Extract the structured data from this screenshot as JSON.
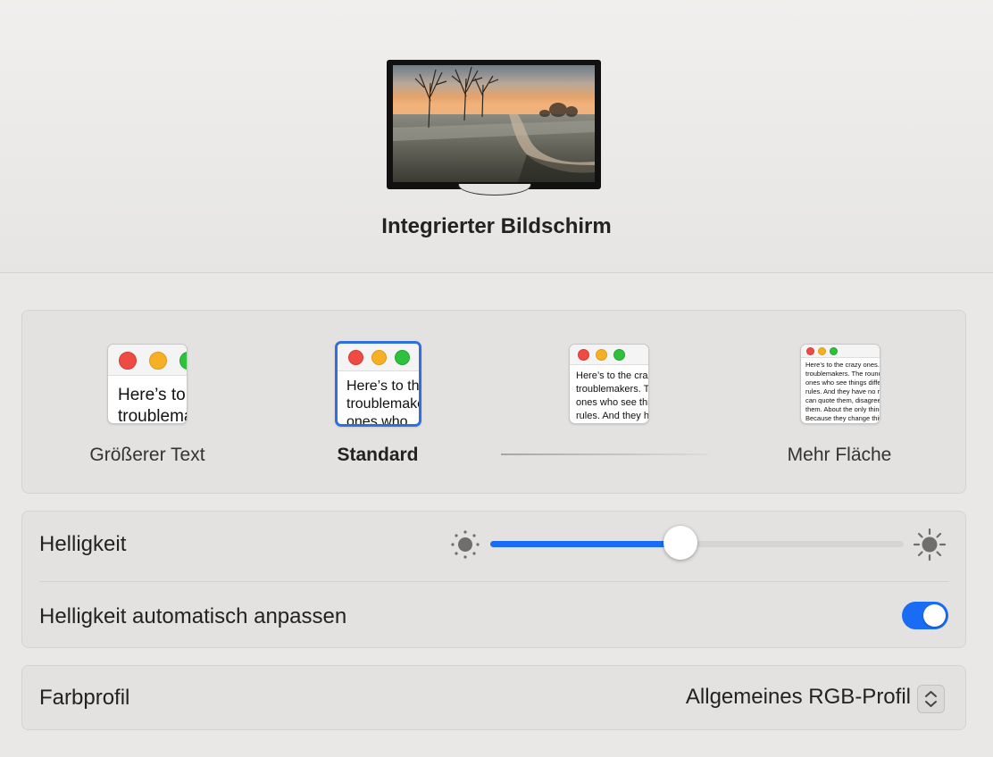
{
  "header": {
    "display_name": "Integrierter Bildschirm"
  },
  "resolution": {
    "options": [
      {
        "label": "Größerer Text",
        "preview_text": "Here’s to the crazy ones\ntroublemakers"
      },
      {
        "label": "Standard",
        "preview_text": "Here’s to the\ntroublemakers\nones who"
      },
      {
        "label": "",
        "preview_text": "Here’s to the crazy ones\ntroublemakers. The\nones who see things\nrules. And they have"
      },
      {
        "label": "Mehr Fläche",
        "preview_text": "Here’s to the crazy ones. The misfits\ntroublemakers. The round pegs\nones who see things differently.\nrules. And they have no respect\ncan quote them, disagree with them\nthem. About the only thing\nBecause they change things"
      }
    ],
    "selected_index": 1
  },
  "brightness": {
    "label": "Helligkeit",
    "value_percent": 46,
    "low_icon": "sun-dim-icon",
    "high_icon": "sun-bright-icon",
    "auto_label": "Helligkeit automatisch anpassen",
    "auto_enabled": true
  },
  "color_profile": {
    "label": "Farbprofil",
    "value": "Allgemeines RGB-Profil"
  },
  "colors": {
    "accent": "#1a6cf5",
    "window_close": "#ee4b44",
    "window_minimize": "#f6b026",
    "window_zoom": "#2ec13d"
  }
}
